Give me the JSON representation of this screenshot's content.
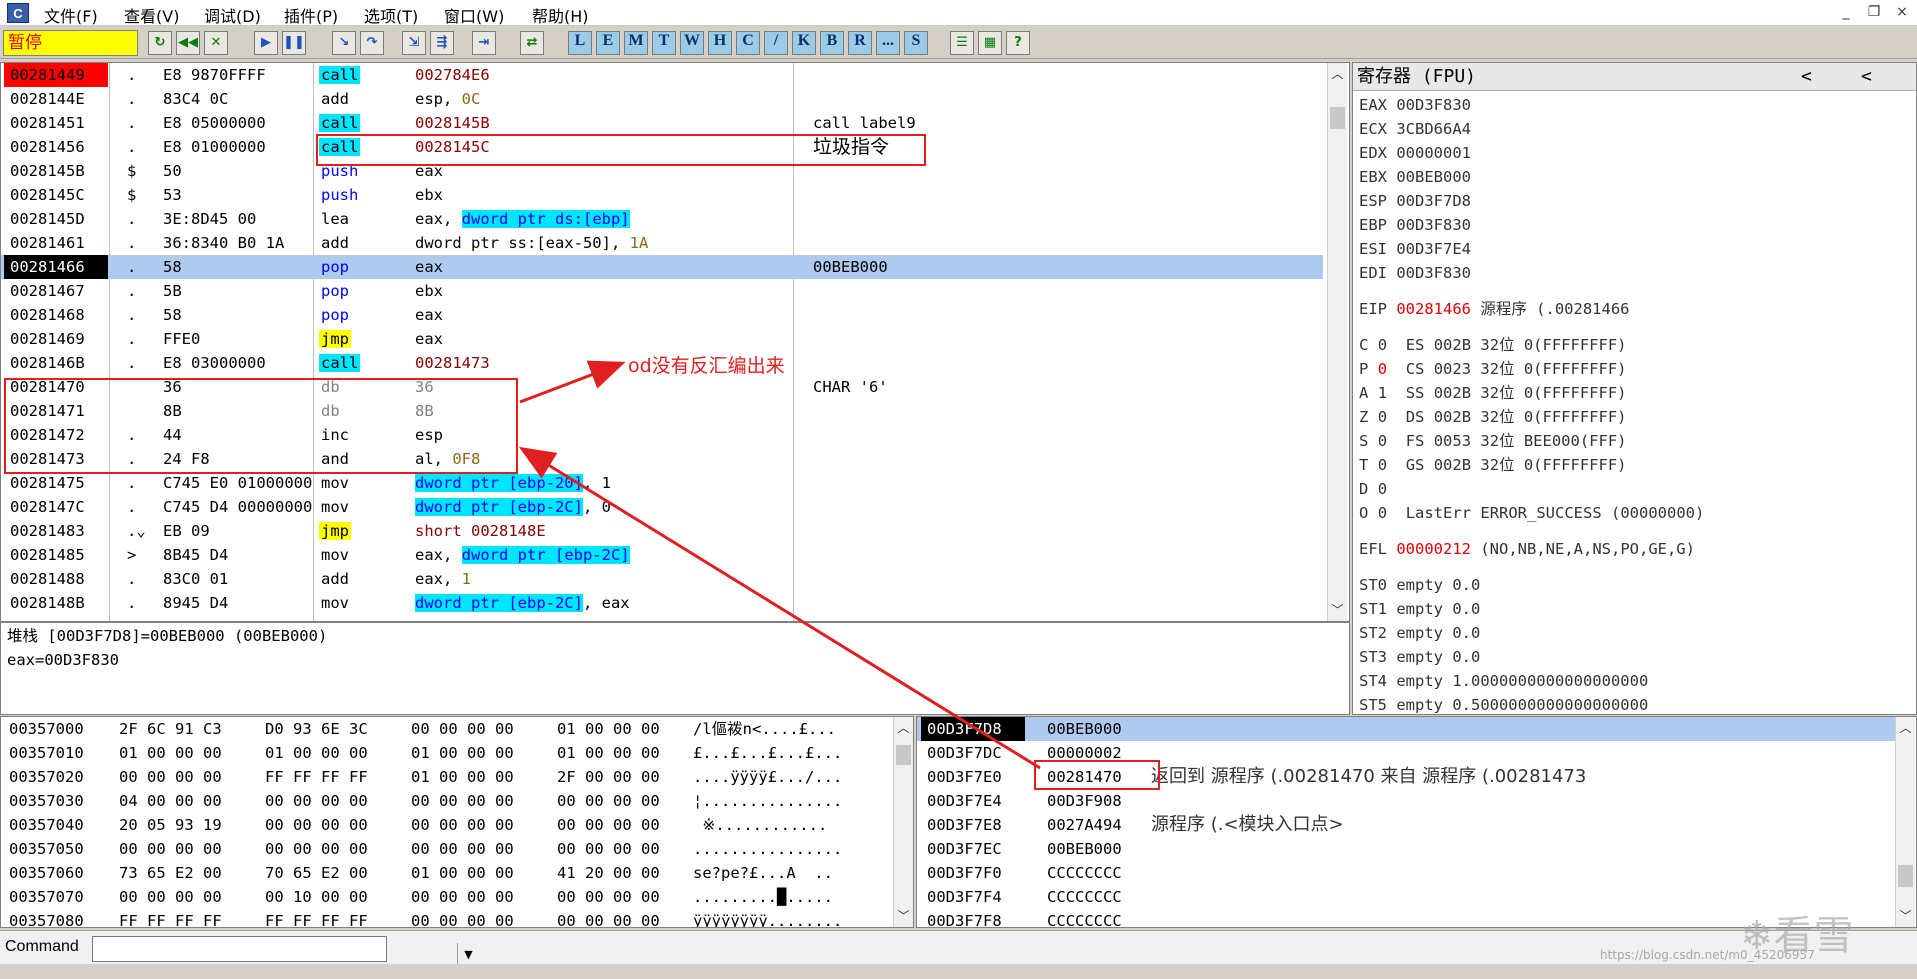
{
  "menubar": {
    "app_icon": "C",
    "items": [
      "文件(F)",
      "查看(V)",
      "调试(D)",
      "插件(P)",
      "选项(T)",
      "窗口(W)",
      "帮助(H)"
    ],
    "min": "_",
    "restore": "❐",
    "close": "×"
  },
  "toolbar": {
    "status": "暂停",
    "letters": [
      "L",
      "E",
      "M",
      "T",
      "W",
      "H",
      "C",
      "/",
      "K",
      "B",
      "R",
      "...",
      "S"
    ]
  },
  "cpu": {
    "rows": [
      {
        "addr": "00281449",
        "mark": ".",
        "hex": "E8 9870FFFF",
        "mn": "call",
        "mnc": "cy",
        "op": "002784E6",
        "opc": "dred",
        "cm": "",
        "astyle": "red"
      },
      {
        "addr": "0028144E",
        "mark": ".",
        "hex": "83C4 0C",
        "mn": "add",
        "mnc": "",
        "op": "esp, ",
        "op2": "0C",
        "op2c": "olv",
        "cm": ""
      },
      {
        "addr": "00281451",
        "mark": ".",
        "hex": "E8 05000000",
        "mn": "call",
        "mnc": "cy",
        "op": "0028145B",
        "opc": "dred",
        "cm": "call label9"
      },
      {
        "addr": "00281456",
        "mark": ".",
        "hex": "E8 01000000",
        "mn": "call",
        "mnc": "cy",
        "op": "0028145C",
        "opc": "dred",
        "cm": "垃圾指令"
      },
      {
        "addr": "0028145B",
        "mark": "$",
        "hex": "50",
        "mn": "push",
        "mnc": "blue",
        "op": "eax",
        "cm": ""
      },
      {
        "addr": "0028145C",
        "mark": "$",
        "hex": "53",
        "mn": "push",
        "mnc": "blue",
        "op": "ebx",
        "cm": ""
      },
      {
        "addr": "0028145D",
        "mark": ".",
        "hex": "3E:8D45 00",
        "mn": "lea",
        "mnc": "",
        "op": "eax, ",
        "op2": "dword ptr ds:[ebp]",
        "op2c": "cyb",
        "cm": ""
      },
      {
        "addr": "00281461",
        "mark": ".",
        "hex": "36:8340 B0 1A",
        "mn": "add",
        "mnc": "",
        "op": "dword ptr ss:[eax-50], ",
        "op2": "1A",
        "op2c": "olv",
        "cm": ""
      },
      {
        "addr": "00281466",
        "mark": ".",
        "hex": "58",
        "mn": "pop",
        "mnc": "blue",
        "op": "eax",
        "cm": "00BEB000",
        "astyle": "blk",
        "sel": true
      },
      {
        "addr": "00281467",
        "mark": ".",
        "hex": "5B",
        "mn": "pop",
        "mnc": "blue",
        "op": "ebx",
        "cm": ""
      },
      {
        "addr": "00281468",
        "mark": ".",
        "hex": "58",
        "mn": "pop",
        "mnc": "blue",
        "op": "eax",
        "cm": ""
      },
      {
        "addr": "00281469",
        "mark": ".",
        "hex": "FFE0",
        "mn": "jmp",
        "mnc": "yl",
        "op": "eax",
        "cm": ""
      },
      {
        "addr": "0028146B",
        "mark": ".",
        "hex": "E8 03000000",
        "mn": "call",
        "mnc": "cy",
        "op": "00281473",
        "opc": "dred",
        "cm": ""
      },
      {
        "addr": "00281470",
        "mark": "",
        "hex": "36",
        "mn": "db",
        "mnc": "gray",
        "op": "36",
        "opc": "gray",
        "cm": "CHAR '6'"
      },
      {
        "addr": "00281471",
        "mark": "",
        "hex": "8B",
        "mn": "db",
        "mnc": "gray",
        "op": "8B",
        "opc": "gray",
        "cm": ""
      },
      {
        "addr": "00281472",
        "mark": ".",
        "hex": "44",
        "mn": "inc",
        "mnc": "",
        "op": "esp",
        "cm": ""
      },
      {
        "addr": "00281473",
        "mark": ".",
        "hex": "24 F8",
        "mn": "and",
        "mnc": "",
        "op": "al, ",
        "op2": "0F8",
        "op2c": "olv",
        "cm": ""
      },
      {
        "addr": "00281475",
        "mark": ".",
        "hex": "C745 E0 01000000",
        "mn": "mov",
        "mnc": "",
        "op": "",
        "op2": "dword ptr [ebp-20]",
        "op2c": "cyb",
        "op3": ", 1",
        "cm": ""
      },
      {
        "addr": "0028147C",
        "mark": ".",
        "hex": "C745 D4 00000000",
        "mn": "mov",
        "mnc": "",
        "op": "",
        "op2": "dword ptr [ebp-2C]",
        "op2c": "cyb",
        "op3": ", 0",
        "cm": ""
      },
      {
        "addr": "00281483",
        "mark": ".⌄",
        "hex": "EB 09",
        "mn": "jmp",
        "mnc": "yl",
        "op": "short 0028148E",
        "opc": "dred",
        "cm": ""
      },
      {
        "addr": "00281485",
        "mark": ">",
        "hex": "8B45 D4",
        "mn": "mov",
        "mnc": "",
        "op": "eax, ",
        "op2": "dword ptr [ebp-2C]",
        "op2c": "cyb",
        "cm": ""
      },
      {
        "addr": "00281488",
        "mark": ".",
        "hex": "83C0 01",
        "mn": "add",
        "mnc": "",
        "op": "eax, ",
        "op2": "1",
        "op2c": "olv",
        "cm": ""
      },
      {
        "addr": "0028148B",
        "mark": ".",
        "hex": "8945 D4",
        "mn": "mov",
        "mnc": "",
        "op": "",
        "op2": "dword ptr [ebp-2C]",
        "op2c": "cyb",
        "op3": ", eax",
        "cm": ""
      }
    ]
  },
  "info": {
    "line1": "堆栈 [00D3F7D8]=00BEB000 (00BEB000)",
    "line2": "eax=00D3F830"
  },
  "regs": {
    "title": "寄存器 (FPU)",
    "arrows": [
      "<",
      "<"
    ],
    "gpr": [
      {
        "n": "EAX",
        "v": "00D3F830"
      },
      {
        "n": "ECX",
        "v": "3CBD66A4"
      },
      {
        "n": "EDX",
        "v": "00000001"
      },
      {
        "n": "EBX",
        "v": "00BEB000"
      },
      {
        "n": "ESP",
        "v": "00D3F7D8"
      },
      {
        "n": "EBP",
        "v": "00D3F830"
      },
      {
        "n": "ESI",
        "v": "00D3F7E4"
      },
      {
        "n": "EDI",
        "v": "00D3F830"
      }
    ],
    "eip": {
      "n": "EIP",
      "v": "00281466",
      "t": "源程序 (.00281466"
    },
    "flags": [
      {
        "f": "C",
        "b": "0",
        "s": "ES 002B 32位 0(FFFFFFFF)"
      },
      {
        "f": "P",
        "b": "0",
        "s": "CS 0023 32位 0(FFFFFFFF)",
        "hl": true
      },
      {
        "f": "A",
        "b": "1",
        "s": "SS 002B 32位 0(FFFFFFFF)"
      },
      {
        "f": "Z",
        "b": "0",
        "s": "DS 002B 32位 0(FFFFFFFF)"
      },
      {
        "f": "S",
        "b": "0",
        "s": "FS 0053 32位 BEE000(FFF)"
      },
      {
        "f": "T",
        "b": "0",
        "s": "GS 002B 32位 0(FFFFFFFF)"
      },
      {
        "f": "D",
        "b": "0",
        "s": ""
      },
      {
        "f": "O",
        "b": "0",
        "s": "LastErr ERROR_SUCCESS (00000000)"
      }
    ],
    "efl": {
      "n": "EFL",
      "v": "00000212",
      "t": "(NO,NB,NE,A,NS,PO,GE,G)"
    },
    "fpu": [
      "ST0 empty 0.0",
      "ST1 empty 0.0",
      "ST2 empty 0.0",
      "ST3 empty 0.0",
      "ST4 empty 1.0000000000000000000",
      "ST5 empty 0.5000000000000000000"
    ]
  },
  "dump": {
    "rows": [
      {
        "a": "00357000",
        "h": [
          "2F 6C 91 C3",
          "D0 93 6E 3C",
          "00 00 00 00",
          "01 00 00 00"
        ],
        "t": "/l傴袯n<....£..."
      },
      {
        "a": "00357010",
        "h": [
          "01 00 00 00",
          "01 00 00 00",
          "01 00 00 00",
          "01 00 00 00"
        ],
        "t": "£...£...£...£..."
      },
      {
        "a": "00357020",
        "h": [
          "00 00 00 00",
          "FF FF FF FF",
          "01 00 00 00",
          "2F 00 00 00"
        ],
        "t": "....ÿÿÿÿ£.../..."
      },
      {
        "a": "00357030",
        "h": [
          "04 00 00 00",
          "00 00 00 00",
          "00 00 00 00",
          "00 00 00 00"
        ],
        "t": "¦..............."
      },
      {
        "a": "00357040",
        "h": [
          "20 05 93 19",
          "00 00 00 00",
          "00 00 00 00",
          "00 00 00 00"
        ],
        "t": " ※............"
      },
      {
        "a": "00357050",
        "h": [
          "00 00 00 00",
          "00 00 00 00",
          "00 00 00 00",
          "00 00 00 00"
        ],
        "t": "................"
      },
      {
        "a": "00357060",
        "h": [
          "73 65 E2 00",
          "70 65 E2 00",
          "01 00 00 00",
          "41 20 00 00"
        ],
        "t": "se?pe?£...A  .."
      },
      {
        "a": "00357070",
        "h": [
          "00 00 00 00",
          "00 10 00 00",
          "00 00 00 00",
          "00 00 00 00"
        ],
        "t": ".........█....."
      },
      {
        "a": "00357080",
        "h": [
          "FF FF FF FF",
          "FF FF FF FF",
          "00 00 00 00",
          "00 00 00 00"
        ],
        "t": "ÿÿÿÿÿÿÿÿ........"
      }
    ]
  },
  "stack": {
    "rows": [
      {
        "a": "00D3F7D8",
        "v": "00BEB000",
        "c": "",
        "sel": true
      },
      {
        "a": "00D3F7DC",
        "v": "00000002",
        "c": ""
      },
      {
        "a": "00D3F7E0",
        "v": "00281470",
        "c": "返回到 源程序 (.00281470 来自 源程序 (.00281473"
      },
      {
        "a": "00D3F7E4",
        "v": "00D3F908",
        "c": ""
      },
      {
        "a": "00D3F7E8",
        "v": "0027A494",
        "c": "源程序 (.<模块入口点>"
      },
      {
        "a": "00D3F7EC",
        "v": "00BEB000",
        "c": ""
      },
      {
        "a": "00D3F7F0",
        "v": "CCCCCCCC",
        "c": ""
      },
      {
        "a": "00D3F7F4",
        "v": "CCCCCCCC",
        "c": ""
      },
      {
        "a": "00D3F7F8",
        "v": "CCCCCCCC",
        "c": ""
      }
    ]
  },
  "command": {
    "label": "Command",
    "value": ""
  },
  "annotations": {
    "junk": "垃圾指令",
    "od_note": "od没有反汇编出来",
    "arrow_color": "#e02020"
  },
  "watermark": {
    "logo": "看雪",
    "url": "https://blog.csdn.net/m0_45206957"
  }
}
